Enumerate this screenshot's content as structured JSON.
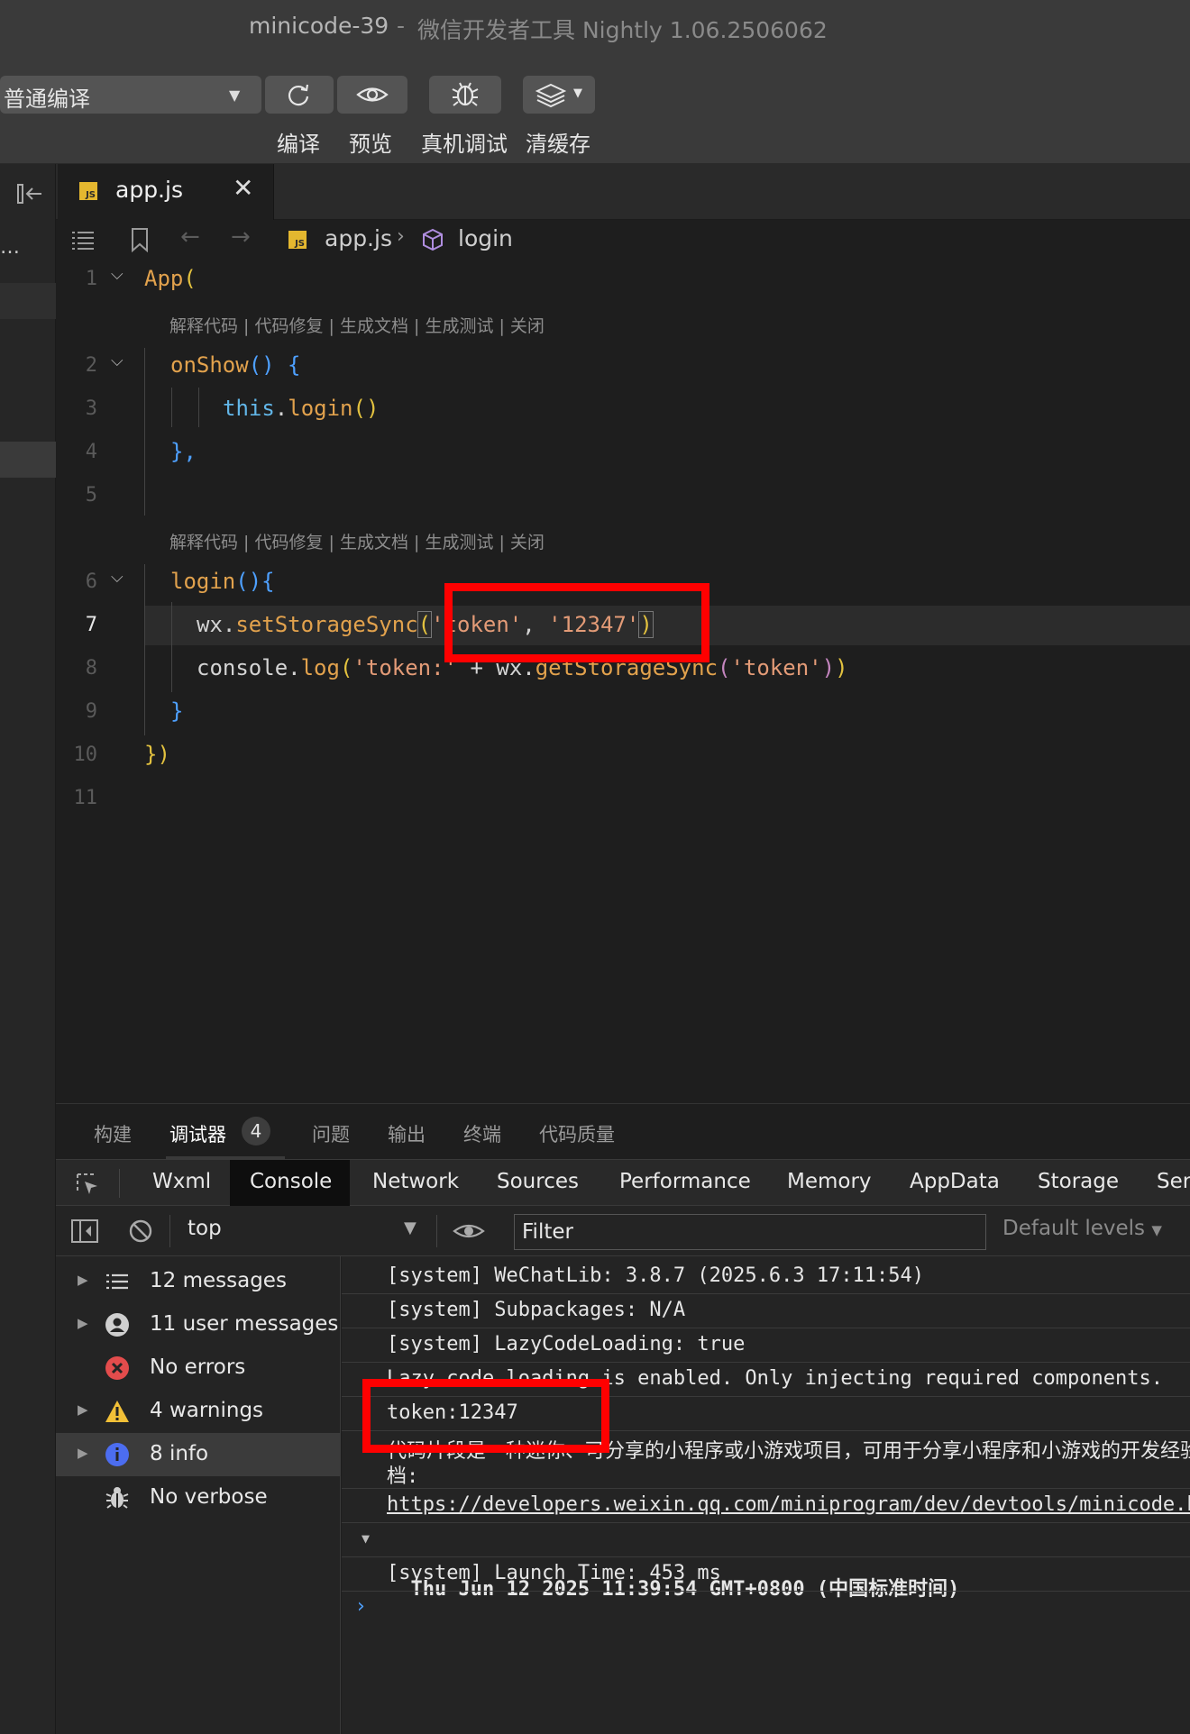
{
  "window": {
    "project": "minicode-39",
    "separator": "-",
    "app": "微信开发者工具 Nightly 1.06.2506062"
  },
  "toolbar": {
    "compile_mode": "普通编译",
    "buttons": {
      "compile": "编译",
      "preview": "预览",
      "remote_debug": "真机调试",
      "clear_cache": "清缓存"
    }
  },
  "editor": {
    "tab": {
      "label": "app.js",
      "icon_text": "JS"
    },
    "breadcrumb": {
      "file": "app.js",
      "symbol": "login"
    },
    "codelens": "解释代码 | 代码修复 | 生成文档 | 生成测试 | 关闭",
    "line_numbers": [
      "1",
      "2",
      "3",
      "4",
      "5",
      "6",
      "7",
      "8",
      "9",
      "10",
      "11"
    ],
    "current_line": "7",
    "code": {
      "l1": [
        "App",
        "("
      ],
      "l2": [
        "onShow",
        "()",
        " {"
      ],
      "l3": [
        "this",
        ".",
        "login",
        "()"
      ],
      "l4": [
        "},"
      ],
      "l6": [
        "login",
        "()",
        "{"
      ],
      "l7": [
        "wx",
        ".",
        "setStorageSync",
        "(",
        "'token'",
        ", ",
        "'12347'",
        ")"
      ],
      "l8": [
        "console",
        ".",
        "log",
        "(",
        "'token:'",
        " + ",
        "wx",
        ".",
        "getStorageSync",
        "(",
        "'token'",
        ")",
        ")"
      ],
      "l9": [
        "}"
      ],
      "l10": [
        "}",
        ")"
      ]
    }
  },
  "bottom_panel": {
    "tabs": [
      "构建",
      "调试器",
      "问题",
      "输出",
      "终端",
      "代码质量"
    ],
    "active_tab": "调试器",
    "debugger_badge": "4",
    "devtools_tabs": [
      "Wxml",
      "Console",
      "Network",
      "Sources",
      "Performance",
      "Memory",
      "AppData",
      "Storage",
      "Ser"
    ],
    "active_devtools_tab": "Console"
  },
  "console_toolbar": {
    "context": "top",
    "filter_placeholder": "Filter",
    "levels": "Default levels"
  },
  "console_sidebar": [
    {
      "label": "12 messages",
      "icon": "list-icon"
    },
    {
      "label": "11 user messages",
      "icon": "user-icon"
    },
    {
      "label": "No errors",
      "icon": "error-icon"
    },
    {
      "label": "4 warnings",
      "icon": "warning-icon"
    },
    {
      "label": "8 info",
      "icon": "info-icon"
    },
    {
      "label": "No verbose",
      "icon": "bug-icon"
    }
  ],
  "console_messages": [
    "[system] WeChatLib: 3.8.7 (2025.6.3 17:11:54)",
    "[system] Subpackages: N/A",
    "[system] LazyCodeLoading: true",
    "Lazy code loading is enabled. Only injecting required components.",
    "token:12347",
    "代码片段是一种迷你、可分享的小程序或小游戏项目，可用于分享小程序和小游戏的开发经验",
    "档:",
    "https://developers.weixin.qq.com/miniprogram/dev/devtools/minicode.html",
    "Thu Jun 12 2025 11:39:54 GMT+0800 (中国标准时间)",
    "[system] Launch Time: 453 ms"
  ],
  "colors": {
    "highlight_box": "#ff0000",
    "js_icon": "#e4b72f",
    "keyword": "#e2a24d",
    "string": "#e39b77",
    "property": "#62b6e8"
  }
}
